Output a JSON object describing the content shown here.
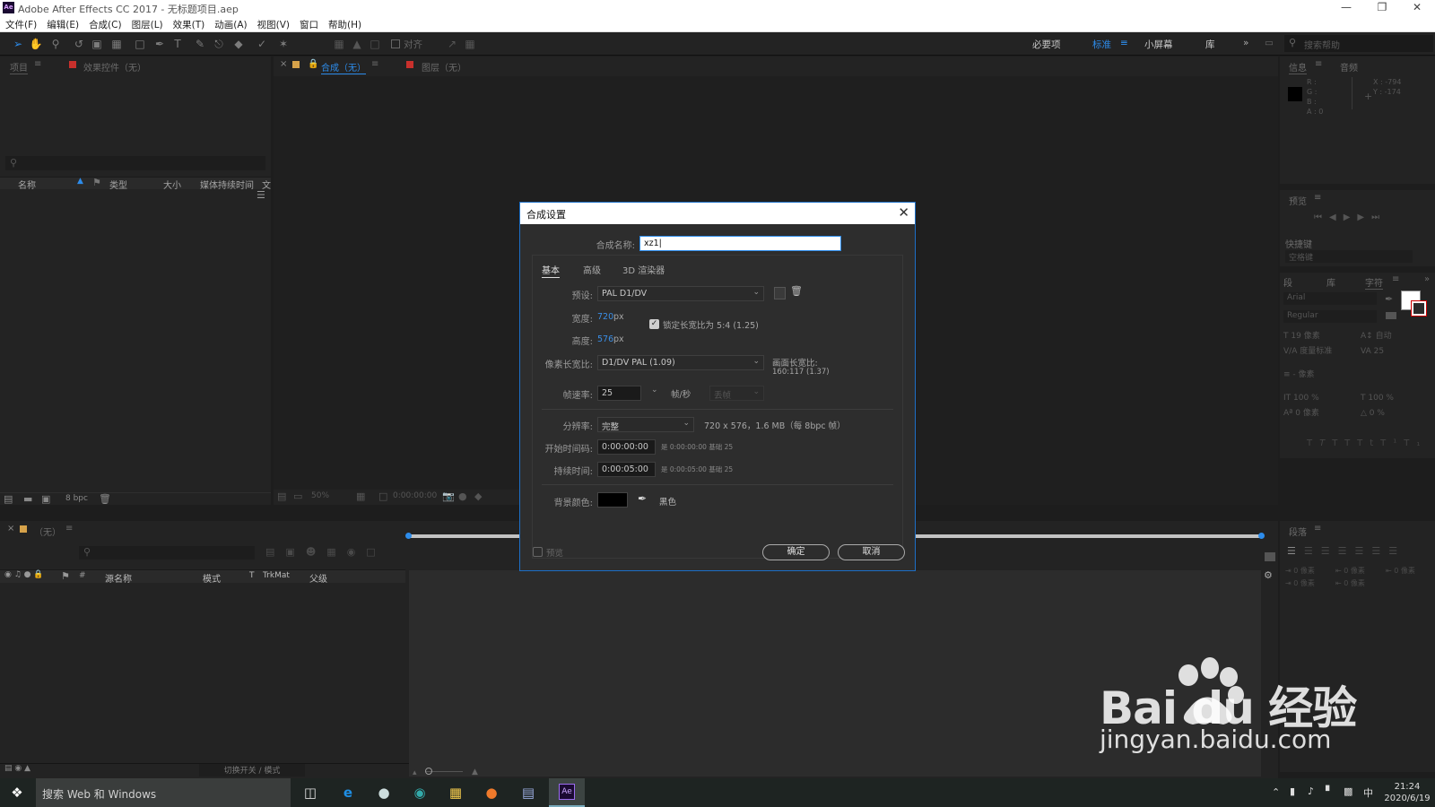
{
  "window": {
    "app_icon": "Ae",
    "title": "Adobe After Effects CC 2017 - 无标题项目.aep"
  },
  "menu": [
    "文件(F)",
    "编辑(E)",
    "合成(C)",
    "图层(L)",
    "效果(T)",
    "动画(A)",
    "视图(V)",
    "窗口",
    "帮助(H)"
  ],
  "toolbar": {
    "align_label": "对齐",
    "workspaces": [
      "必要项",
      "标准",
      "小屏幕",
      "库"
    ],
    "active_workspace": "标准",
    "search_help_placeholder": "搜索帮助"
  },
  "project_panel": {
    "tab_project": "项目",
    "tab_effects": "效果控件（无）",
    "columns": [
      "名称",
      "类型",
      "大小",
      "媒体持续时间",
      "文"
    ],
    "bpc": "8 bpc"
  },
  "comp_viewer": {
    "tab_comp": "合成（无）",
    "tab_layer": "图层（无）",
    "zoom": "50%",
    "timecode": "0:00:00:00"
  },
  "timeline": {
    "tab": "（无）",
    "columns": [
      "源名称",
      "模式",
      "T",
      "TrkMat",
      "父级"
    ],
    "toggle_label": "切换开关 / 模式"
  },
  "info_panel": {
    "tab_info": "信息",
    "tab_audio": "音频",
    "r": "R :",
    "g": "G :",
    "b": "B :",
    "a": "A : 0",
    "x": "X : -794",
    "y": "Y : -174"
  },
  "preview_panel": {
    "title": "预览",
    "shortcut_label": "快捷键",
    "shortcut_value": "空格键"
  },
  "character_panel": {
    "tab_effects": "段",
    "tab_library": "库",
    "tab_character": "字符",
    "font": "Arial",
    "style": "Regular",
    "size": "19 像素",
    "leading": "自动",
    "kerning": "度量标准",
    "tracking": "25",
    "stroke": "- 像素",
    "vscale": "100 %",
    "hscale": "100 %",
    "baseline": "0 像素",
    "tsume": "0 %"
  },
  "paragraph_panel": {
    "title": "段落",
    "indent_left": "0 像素",
    "indent_right": "0 像素",
    "space_before": "0 像素",
    "space_after": "0 像素",
    "indent_first": "0 像素"
  },
  "dialog": {
    "title": "合成设置",
    "name_label": "合成名称:",
    "name_value": "xz1",
    "tabs": [
      "基本",
      "高级",
      "3D 渲染器"
    ],
    "preset_label": "预设:",
    "preset_value": "PAL D1/DV",
    "width_label": "宽度:",
    "width_value": "720",
    "height_label": "高度:",
    "height_value": "576",
    "unit_px": "px",
    "lock_aspect_label": "锁定长宽比为 5:4 (1.25)",
    "pixel_aspect_label": "像素长宽比:",
    "pixel_aspect_value": "D1/DV PAL (1.09)",
    "frame_aspect_label": "画面长宽比:",
    "frame_aspect_value": "160:117 (1.37)",
    "framerate_label": "帧速率:",
    "framerate_value": "25",
    "framerate_unit": "帧/秒",
    "dropframe_value": "丢帧",
    "resolution_label": "分辨率:",
    "resolution_value": "完整",
    "resolution_info": "720 x 576，1.6 MB（每 8bpc 帧）",
    "start_tc_label": "开始时间码:",
    "start_tc_value": "0:00:00:00",
    "start_tc_info": "是 0:00:00:00  基础 25",
    "duration_label": "持续时间:",
    "duration_value": "0:00:05:00",
    "duration_info": "是 0:00:05:00  基础 25",
    "bg_label": "背景颜色:",
    "bg_color": "#000000",
    "bg_name": "黑色",
    "preview_label": "预览",
    "ok": "确定",
    "cancel": "取消"
  },
  "taskbar": {
    "search_text": "搜索 Web 和 Windows",
    "time": "21:24",
    "date": "2020/6/19",
    "ime": "中"
  },
  "watermark": {
    "brand": "Bai du 经验",
    "url": "jingyan.baidu.com"
  },
  "colors": {
    "accent": "#2d8ceb",
    "dialog_border": "#1d6fc6",
    "panel_bg": "#232323"
  }
}
